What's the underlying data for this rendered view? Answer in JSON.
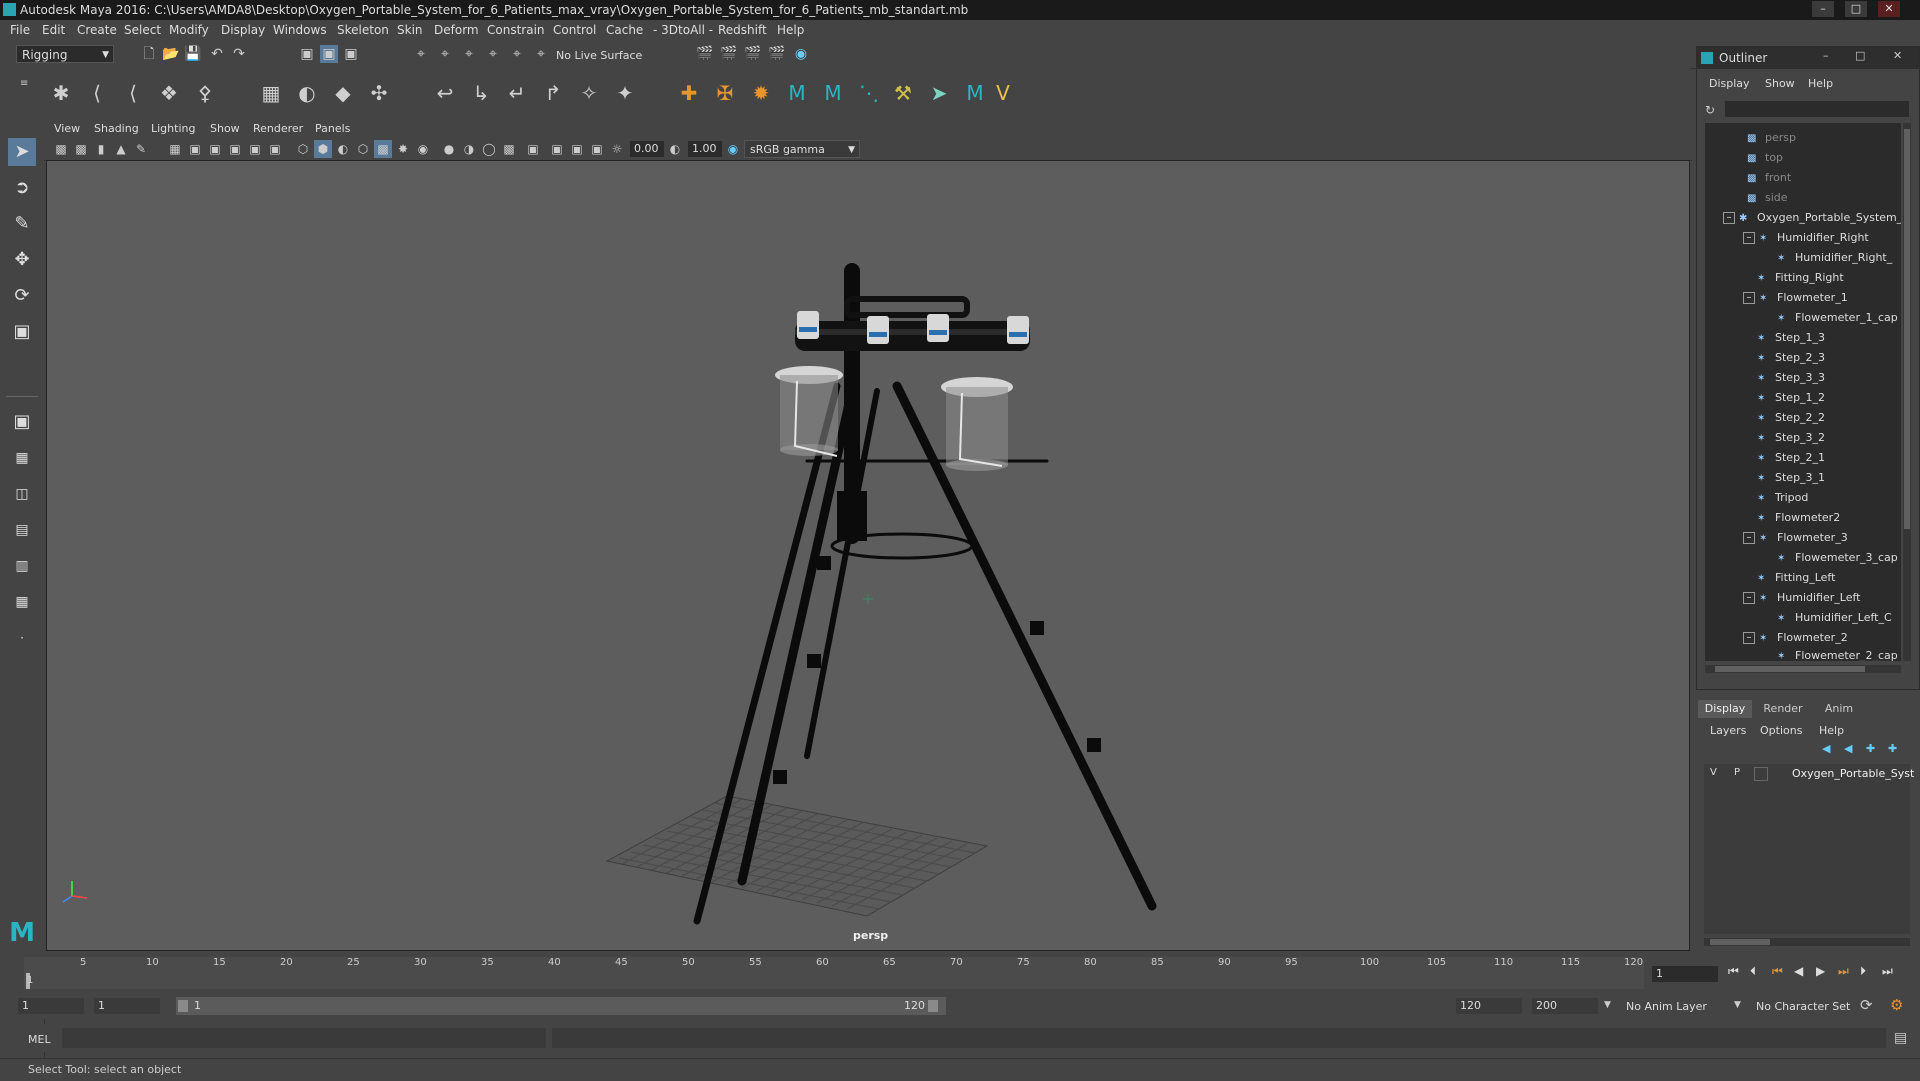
{
  "window": {
    "title": "Autodesk Maya 2016: C:\\Users\\AMDA8\\Desktop\\Oxygen_Portable_System_for_6_Patients_max_vray\\Oxygen_Portable_System_for_6_Patients_mb_standart.mb"
  },
  "menubar": [
    "File",
    "Edit",
    "Create",
    "Select",
    "Modify",
    "Display",
    "Windows",
    "Skeleton",
    "Skin",
    "Deform",
    "Constrain",
    "Control",
    "Cache",
    "- 3DtoAll -",
    "Redshift",
    "Help"
  ],
  "statusline": {
    "mode": "Rigging",
    "live_surface": "No Live Surface"
  },
  "panel_menu": [
    "View",
    "Shading",
    "Lighting",
    "Show",
    "Renderer",
    "Panels"
  ],
  "panel_bar": {
    "exposure": "0.00",
    "gamma": "1.00",
    "color_space": "sRGB gamma"
  },
  "viewport": {
    "camera_label": "persp"
  },
  "outliner": {
    "title": "Outliner",
    "menu": [
      "Display",
      "Show",
      "Help"
    ],
    "items": [
      {
        "label": "persp",
        "type": "camera",
        "dim": true
      },
      {
        "label": "top",
        "type": "camera",
        "dim": true
      },
      {
        "label": "front",
        "type": "camera",
        "dim": true
      },
      {
        "label": "side",
        "type": "camera",
        "dim": true
      },
      {
        "label": "Oxygen_Portable_System_",
        "type": "group"
      },
      {
        "label": "Humidifier_Right",
        "type": "mesh"
      },
      {
        "label": "Humidifier_Right_",
        "type": "mesh"
      },
      {
        "label": "Fitting_Right",
        "type": "mesh"
      },
      {
        "label": "Flowmeter_1",
        "type": "mesh"
      },
      {
        "label": "Flowemeter_1_cap",
        "type": "mesh"
      },
      {
        "label": "Step_1_3",
        "type": "mesh"
      },
      {
        "label": "Step_2_3",
        "type": "mesh"
      },
      {
        "label": "Step_3_3",
        "type": "mesh"
      },
      {
        "label": "Step_1_2",
        "type": "mesh"
      },
      {
        "label": "Step_2_2",
        "type": "mesh"
      },
      {
        "label": "Step_3_2",
        "type": "mesh"
      },
      {
        "label": "Step_2_1",
        "type": "mesh"
      },
      {
        "label": "Step_3_1",
        "type": "mesh"
      },
      {
        "label": "Tripod",
        "type": "mesh"
      },
      {
        "label": "Flowmeter2",
        "type": "mesh"
      },
      {
        "label": "Flowmeter_3",
        "type": "mesh"
      },
      {
        "label": "Flowemeter_3_cap",
        "type": "mesh"
      },
      {
        "label": "Fitting_Left",
        "type": "mesh"
      },
      {
        "label": "Humidifier_Left",
        "type": "mesh"
      },
      {
        "label": "Humidifier_Left_C",
        "type": "mesh"
      },
      {
        "label": "Flowmeter_2",
        "type": "mesh"
      },
      {
        "label": "Flowemeter_2_cap",
        "type": "mesh"
      }
    ]
  },
  "layers": {
    "tabs": [
      "Display",
      "Render",
      "Anim"
    ],
    "menu": [
      "Layers",
      "Options",
      "Help"
    ],
    "row": {
      "v": "V",
      "p": "P",
      "name": "Oxygen_Portable_Syst"
    }
  },
  "timeline": {
    "ticks": [
      "1",
      "5",
      "10",
      "15",
      "20",
      "25",
      "30",
      "35",
      "40",
      "45",
      "50",
      "55",
      "60",
      "65",
      "70",
      "75",
      "80",
      "85",
      "90",
      "95",
      "100",
      "105",
      "110",
      "115",
      "120"
    ],
    "current_frame": "1"
  },
  "range": {
    "start": "1",
    "playback_start": "1",
    "slider_start": "1",
    "slider_end": "120",
    "playback_end": "120",
    "end": "200",
    "anim_layer": "No Anim Layer",
    "character_set": "No Character Set"
  },
  "cmdline": {
    "label": "MEL"
  },
  "helpline": {
    "text": "Select Tool: select an object"
  }
}
